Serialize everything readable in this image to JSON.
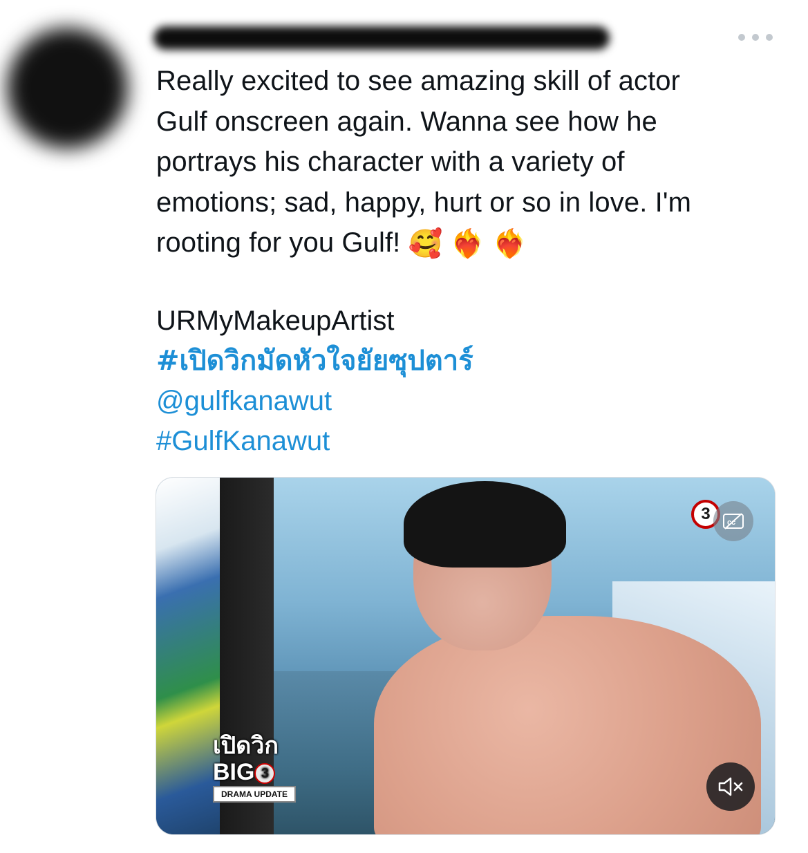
{
  "tweet": {
    "text_lines": [
      "Really excited to see amazing skill of actor",
      "Gulf onscreen again. Wanna see how he",
      "portrays his character with a variety of",
      "emotions; sad, happy, hurt or so in love. I'm",
      "rooting for you Gulf!"
    ],
    "emojis": [
      "🥰",
      "❤️‍🔥",
      "❤️‍🔥"
    ],
    "tags": {
      "plain": "URMyMakeupArtist",
      "hashtag_thai": "#เปิดวิกมัดหัวใจยัยซุปตาร์",
      "mention": "@gulfkanawut",
      "hashtag": "#GulfKanawut"
    }
  },
  "media": {
    "watermark_thai": "เปิดวิก",
    "watermark_big": "BIG",
    "watermark_three": "3",
    "watermark_caption": "DRAMA UPDATE",
    "channel_logo": "3"
  },
  "icons": {
    "more": "more-horizontal-icon",
    "captions": "closed-captions-off-icon",
    "mute": "volume-muted-icon"
  },
  "colors": {
    "text": "#0f1419",
    "link": "#1d8fd6",
    "more_dots": "#c3c9cf"
  }
}
